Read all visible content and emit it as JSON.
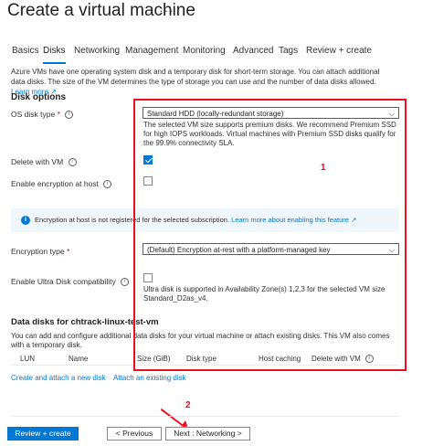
{
  "page": {
    "title": "Create a virtual machine",
    "more_label": "···"
  },
  "tabs": [
    {
      "label": "Basics"
    },
    {
      "label": "Disks"
    },
    {
      "label": "Networking"
    },
    {
      "label": "Management"
    },
    {
      "label": "Monitoring"
    },
    {
      "label": "Advanced"
    },
    {
      "label": "Tags"
    },
    {
      "label": "Review + create"
    }
  ],
  "active_tab": "Disks",
  "intro": {
    "text": "Azure VMs have one operating system disk and a temporary disk for short-term storage. You can attach additional data disks. The size of the VM determines the type of storage you can use and the number of data disks allowed.",
    "learn_more": "Learn more"
  },
  "disk_options": {
    "heading": "Disk options",
    "os_disk_type_label": "OS disk type",
    "os_disk_type_value": "Standard HDD (locally-redundant storage)",
    "os_disk_help": "The selected VM size supports premium disks. We recommend Premium SSD for high IOPS workloads. Virtual machines with Premium SSD disks qualify for the 99.9% connectivity SLA.",
    "delete_with_vm_label": "Delete with VM",
    "delete_with_vm_checked": true,
    "encryption_at_host_label": "Enable encryption at host",
    "encryption_at_host_checked": false
  },
  "banner": {
    "text": "Encryption at host is not registered for the selected subscription.",
    "link": "Learn more about enabling this feature"
  },
  "encryption": {
    "label": "Encryption type",
    "value": "(Default) Encryption at-rest with a platform-managed key"
  },
  "ultra_disk": {
    "label": "Enable Ultra Disk compatibility",
    "checked": false,
    "help": "Ultra disk is supported in Availability Zone(s) 1,2,3 for the selected VM size Standard_D2as_v4."
  },
  "data_disks": {
    "heading": "Data disks for chtrack-linux-test-vm",
    "description": "You can add and configure additional data disks for your virtual machine or attach existing disks. This VM also comes with a temporary disk.",
    "columns": [
      "LUN",
      "Name",
      "Size (GiB)",
      "Disk type",
      "Host caching",
      "Delete with VM"
    ],
    "create_link": "Create and attach a new disk",
    "attach_link": "Attach an existing disk"
  },
  "annotations": {
    "label_1": "1",
    "label_2": "2",
    "accent": "#e81123"
  },
  "footer": {
    "review_create": "Review + create",
    "previous": "< Previous",
    "next": "Next : Networking >"
  },
  "colors": {
    "primary": "#0078d4",
    "annotation": "#e81123",
    "banner_bg": "#eff6fc"
  }
}
